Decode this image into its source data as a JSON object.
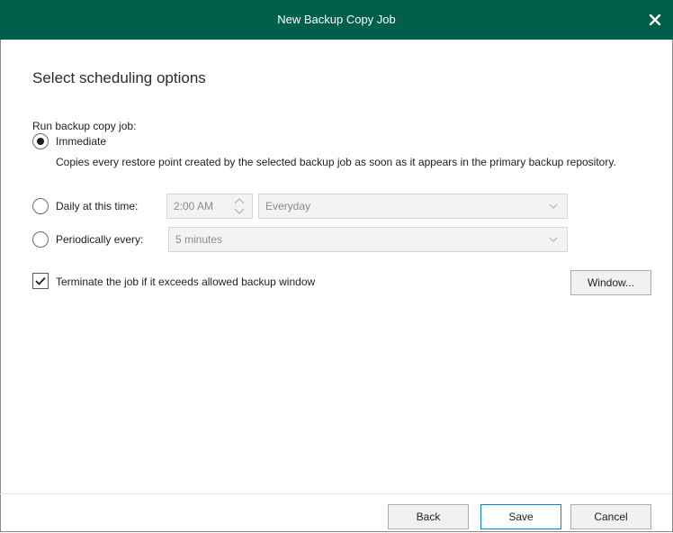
{
  "window": {
    "title": "New Backup Copy Job",
    "close_icon": "close-icon"
  },
  "page": {
    "heading": "Select scheduling options"
  },
  "schedule": {
    "label": "Run backup copy job:",
    "immediate": {
      "label": "Immediate",
      "selected": true,
      "description": "Copies every restore point created by the selected backup job as soon as it appears in the primary backup repository."
    },
    "daily": {
      "label": "Daily at this time:",
      "selected": false,
      "time": "2:00 AM",
      "days": "Everyday"
    },
    "periodic": {
      "label": "Periodically every:",
      "selected": false,
      "interval": "5 minutes"
    }
  },
  "terminate": {
    "label": "Terminate the job if it exceeds allowed backup window",
    "checked": true,
    "window_button": "Window..."
  },
  "footer": {
    "back": "Back",
    "save": "Save",
    "cancel": "Cancel"
  },
  "colors": {
    "titlebar": "#005f4b",
    "primary_border": "#0a7fd6"
  }
}
